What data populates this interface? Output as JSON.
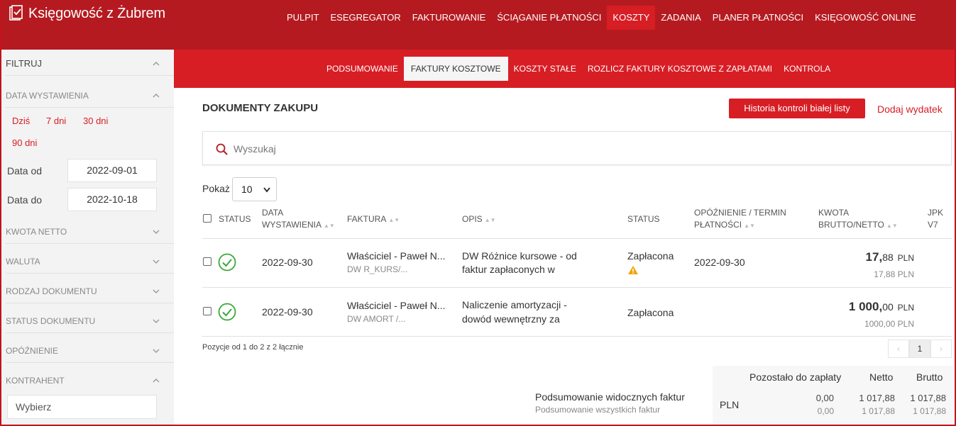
{
  "app": {
    "title": "Księgowość z Żubrem"
  },
  "topnav": {
    "items": [
      "PULPIT",
      "ESEGREGATOR",
      "FAKTUROWANIE",
      "ŚCIĄGANIE PŁATNOŚCI",
      "KOSZTY",
      "ZADANIA",
      "PLANER PŁATNOŚCI",
      "KSIĘGOWOŚĆ ONLINE"
    ],
    "active": "KOSZTY"
  },
  "subnav": {
    "items": [
      "PODSUMOWANIE",
      "FAKTURY KOSZTOWE",
      "KOSZTY STAŁE",
      "ROZLICZ FAKTURY KOSZTOWE Z ZAPŁATAMI",
      "KONTROLA"
    ],
    "active": "FAKTURY KOSZTOWE"
  },
  "sidebar": {
    "filter_title": "FILTRUJ",
    "date_section": "DATA WYSTAWIENIA",
    "quick": [
      "Dziś",
      "7 dni",
      "30 dni",
      "90 dni"
    ],
    "date_from_label": "Data od",
    "date_from": "2022-09-01",
    "date_to_label": "Data do",
    "date_to": "2022-10-18",
    "sections": [
      "KWOTA NETTO",
      "WALUTA",
      "RODZAJ DOKUMENTU",
      "STATUS DOKUMENTU",
      "OPÓŹNIENIE",
      "KONTRAHENT"
    ],
    "contractor_placeholder": "Wybierz"
  },
  "main": {
    "title": "DOKUMENTY ZAKUPU",
    "history_button": "Historia kontroli białej listy",
    "add_link": "Dodaj wydatek",
    "search_placeholder": "Wyszukaj",
    "show_label": "Pokaż",
    "show_value": "10",
    "columns": {
      "status": "STATUS",
      "date_l1": "DATA",
      "date_l2": "WYSTAWIENIA",
      "invoice": "FAKTURA",
      "desc": "OPIS",
      "status2": "STATUS",
      "delay_l1": "OPÓŹNIENIE / TERMIN",
      "delay_l2": "PŁATNOŚCI",
      "amount_l1": "KWOTA",
      "amount_l2": "BRUTTO/NETTO",
      "jpk_l1": "JPK",
      "jpk_l2": "V7"
    },
    "rows": [
      {
        "date": "2022-09-30",
        "invoice": "Właściciel - Paweł N...",
        "invoice_sub": "DW R_KURS/...",
        "desc_l1": "DW Różnice kursowe - od",
        "desc_l2": "faktur zapłaconych w",
        "status": "Zapłacona",
        "warning": true,
        "due": "2022-09-30",
        "gross_int": "17,",
        "gross_dec": "88",
        "currency": "PLN",
        "net": "17,88 PLN"
      },
      {
        "date": "2022-09-30",
        "invoice": "Właściciel - Paweł N...",
        "invoice_sub": "DW AMORT /...",
        "desc_l1": "Naliczenie amortyzacji -",
        "desc_l2": "dowód wewnętrzny za",
        "status": "Zapłacona",
        "warning": false,
        "due": "",
        "gross_int": "1 000,",
        "gross_dec": "00",
        "currency": "PLN",
        "net": "1000,00 PLN"
      }
    ],
    "positions": "Pozycje od 1 do 2 z 2 łącznie",
    "pager": {
      "prev": "‹",
      "current": "1",
      "next": "›"
    }
  },
  "summary": {
    "h_remaining": "Pozostało do zapłaty",
    "h_net": "Netto",
    "h_gross": "Brutto",
    "visible_label": "Podsumowanie widocznych faktur",
    "all_label": "Podsumowanie wszystkich faktur",
    "currency": "PLN",
    "visible": {
      "remaining": "0,00",
      "net": "1 017,88",
      "gross": "1 017,88"
    },
    "all": {
      "remaining": "0,00",
      "net": "1 017,88",
      "gross": "1 017,88"
    }
  },
  "colors": {
    "brand": "#d71e25",
    "brand_dark": "#b51a20",
    "ok": "#3aa83a",
    "warn": "#f0a500"
  }
}
